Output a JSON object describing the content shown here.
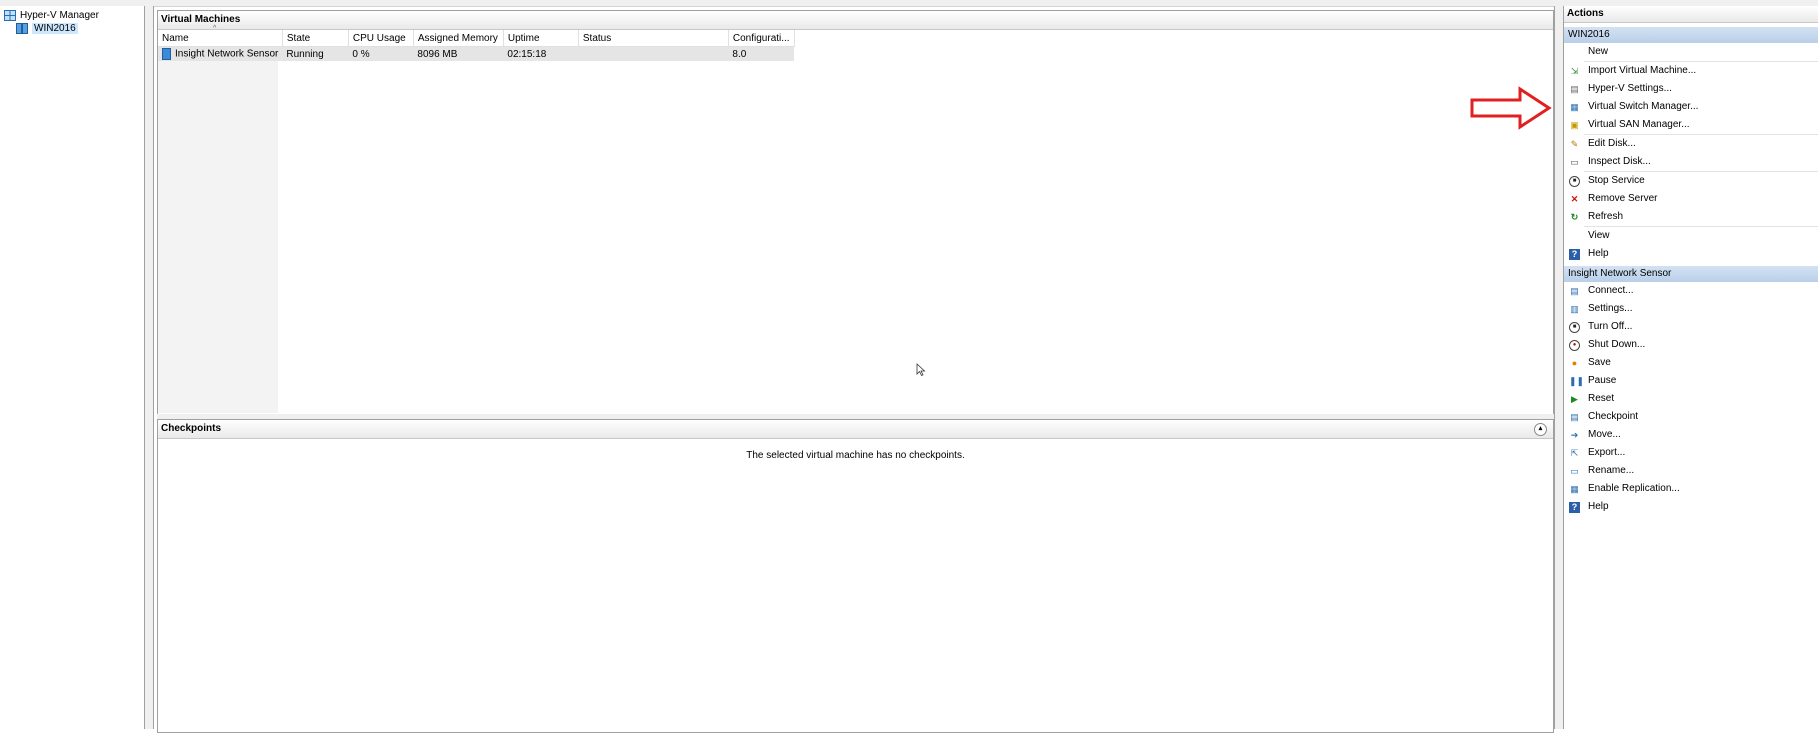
{
  "tree": {
    "root": "Hyper-V Manager",
    "server": "WIN2016"
  },
  "vm_pane": {
    "title": "Virtual Machines",
    "columns": [
      "Name",
      "State",
      "CPU Usage",
      "Assigned Memory",
      "Uptime",
      "Status",
      "Configurati..."
    ],
    "rows": [
      {
        "name": "Insight Network Sensor",
        "state": "Running",
        "cpu": "0 %",
        "memory": "8096 MB",
        "uptime": "02:15:18",
        "status": "",
        "config": "8.0"
      }
    ]
  },
  "checkpoints_pane": {
    "title": "Checkpoints",
    "message": "The selected virtual machine has no checkpoints."
  },
  "actions": {
    "title": "Actions",
    "server_group": "WIN2016",
    "server_items": [
      {
        "label": "New",
        "icon": "none"
      },
      {
        "label": "Import Virtual Machine...",
        "icon": "import-icon"
      },
      {
        "label": "Hyper-V Settings...",
        "icon": "settings-page-icon"
      },
      {
        "label": "Virtual Switch Manager...",
        "icon": "switch-icon"
      },
      {
        "label": "Virtual SAN Manager...",
        "icon": "san-icon"
      },
      {
        "label": "Edit Disk...",
        "icon": "edit-disk-icon"
      },
      {
        "label": "Inspect Disk...",
        "icon": "inspect-disk-icon"
      },
      {
        "label": "Stop Service",
        "icon": "stop-icon"
      },
      {
        "label": "Remove Server",
        "icon": "remove-icon"
      },
      {
        "label": "Refresh",
        "icon": "refresh-icon"
      },
      {
        "label": "View",
        "icon": "none"
      },
      {
        "label": "Help",
        "icon": "help-icon"
      }
    ],
    "vm_group": "Insight Network Sensor",
    "vm_items": [
      {
        "label": "Connect...",
        "icon": "connect-icon"
      },
      {
        "label": "Settings...",
        "icon": "settings-icon"
      },
      {
        "label": "Turn Off...",
        "icon": "turn-off-icon"
      },
      {
        "label": "Shut Down...",
        "icon": "shutdown-icon"
      },
      {
        "label": "Save",
        "icon": "save-icon"
      },
      {
        "label": "Pause",
        "icon": "pause-icon"
      },
      {
        "label": "Reset",
        "icon": "reset-icon"
      },
      {
        "label": "Checkpoint",
        "icon": "checkpoint-icon"
      },
      {
        "label": "Move...",
        "icon": "move-icon"
      },
      {
        "label": "Export...",
        "icon": "export-icon"
      },
      {
        "label": "Rename...",
        "icon": "rename-icon"
      },
      {
        "label": "Enable Replication...",
        "icon": "replication-icon"
      },
      {
        "label": "Help",
        "icon": "help-icon"
      }
    ]
  },
  "colors": {
    "annotation_arrow": "#e02020",
    "group_header": "#c6d9ef",
    "selection": "#cce8ff"
  }
}
